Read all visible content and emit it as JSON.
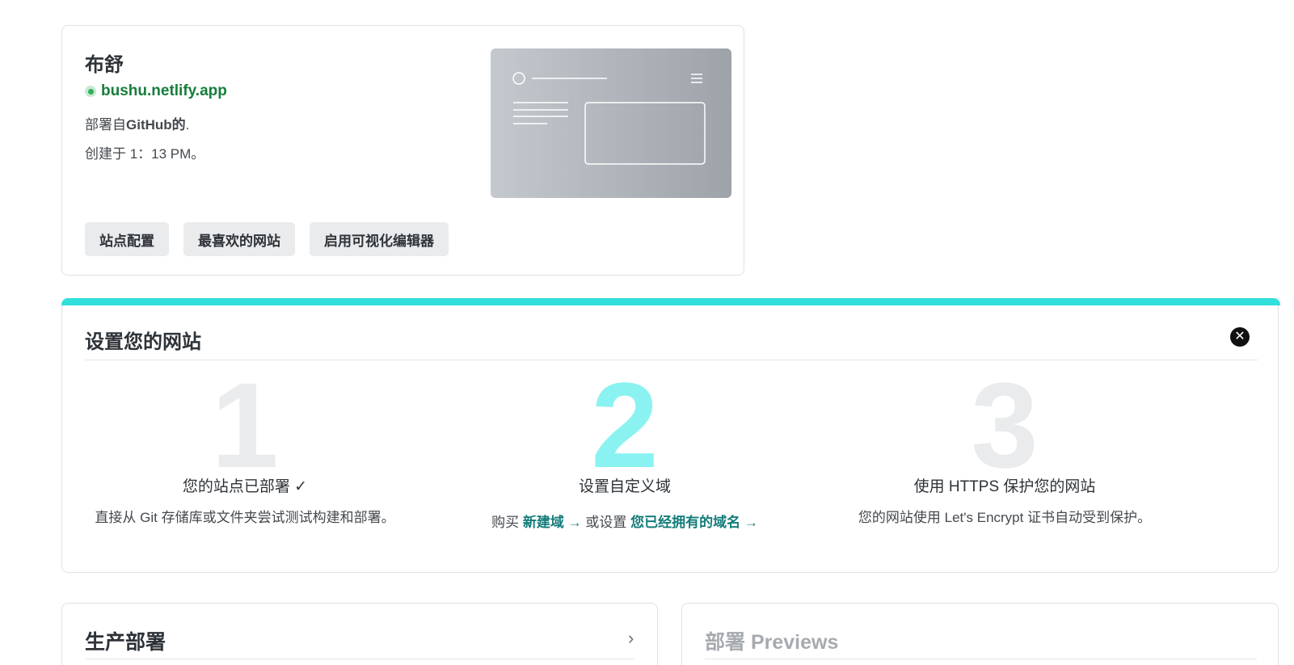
{
  "site": {
    "name": "布舒",
    "url": "bushu.netlify.app",
    "deployed_prefix": "部署自",
    "deployed_source": "GitHub的",
    "deployed_suffix": ".",
    "created": "创建于 1：13 PM。",
    "actions": [
      "站点配置",
      "最喜欢的网站",
      "启用可视化编辑器"
    ]
  },
  "setup": {
    "title": "设置您的网站",
    "close_icon": "close-icon",
    "steps": [
      {
        "number": "1",
        "title": "您的站点已部署 ✓",
        "desc": "直接从 Git 存储库或文件夹尝试测试构建和部署。"
      },
      {
        "number": "2",
        "title": "设置自定义域",
        "desc_prefix": "购买 ",
        "link1": "新建域 →",
        "desc_mid": " 或设置 ",
        "link2": "您已经拥有的域名 →"
      },
      {
        "number": "3",
        "title": "使用 HTTPS 保护您的网站",
        "desc": "您的网站使用 Let's Encrypt 证书自动受到保护。"
      }
    ]
  },
  "panels": {
    "production": {
      "title": "生产部署",
      "chevron": "›"
    },
    "previews": {
      "title": "部署 Previews"
    }
  },
  "colors": {
    "accent": "#31e0dc",
    "status_green": "#30b05a",
    "link_teal": "#137c7a",
    "step_active": "#8af3f1"
  }
}
